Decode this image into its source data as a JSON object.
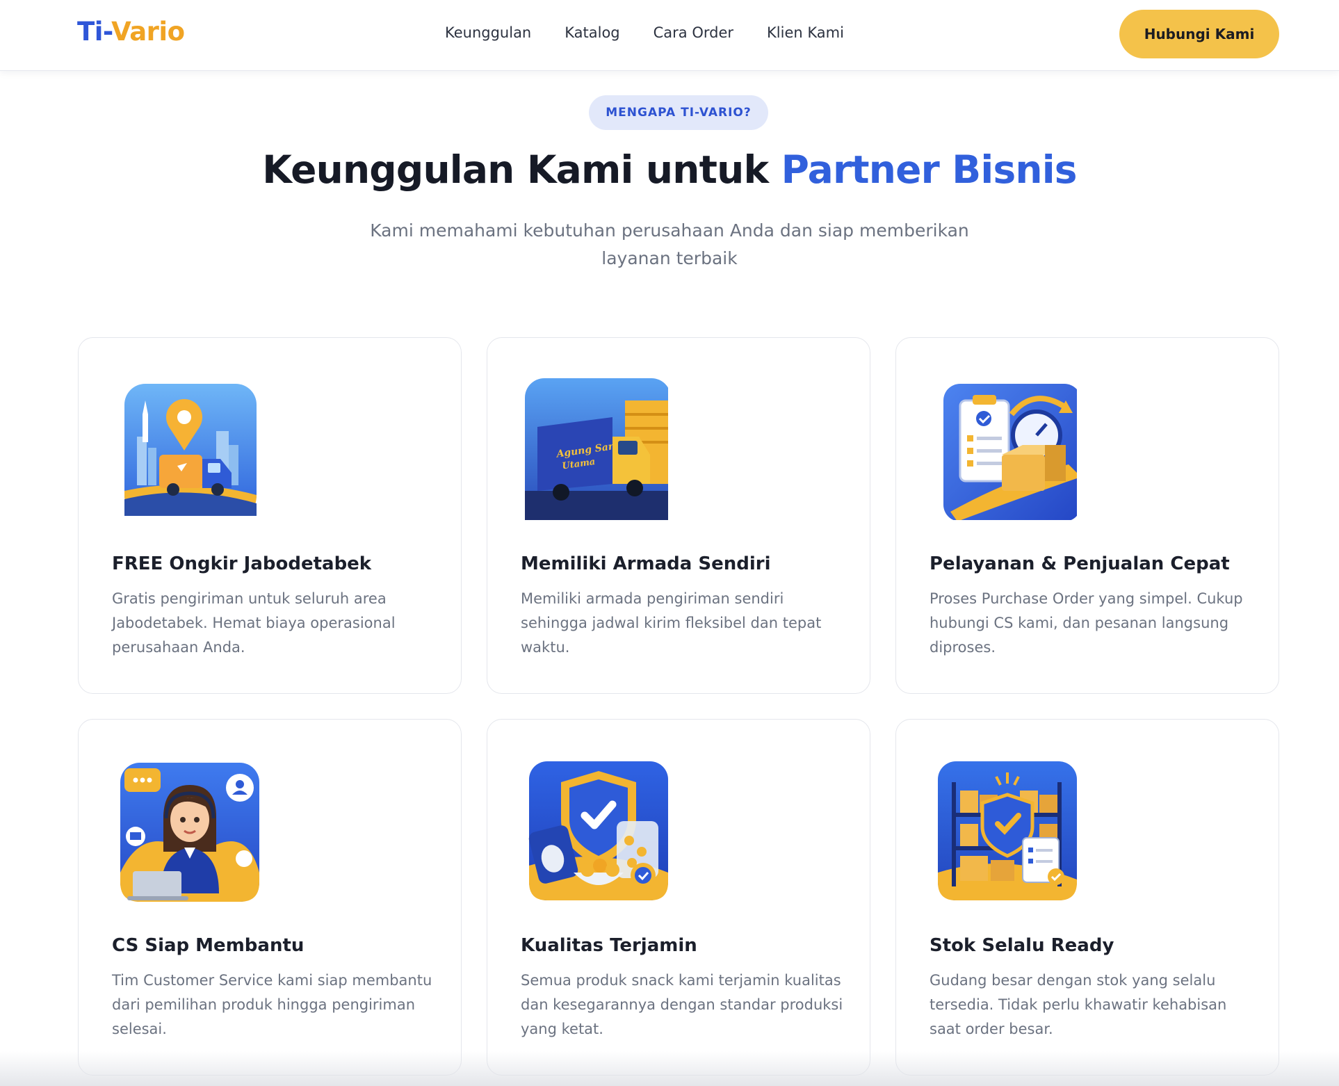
{
  "brand": {
    "name_part1": "Ti-",
    "name_part2": "Vario"
  },
  "nav": {
    "links": [
      {
        "label": "Keunggulan"
      },
      {
        "label": "Katalog"
      },
      {
        "label": "Cara Order"
      },
      {
        "label": "Klien Kami"
      }
    ],
    "cta_label": "Hubungi Kami"
  },
  "hero": {
    "badge": "MENGAPA TI-VARIO?",
    "title_main": "Keunggulan Kami untuk ",
    "title_accent": "Partner Bisnis",
    "subtitle": "Kami memahami kebutuhan perusahaan Anda dan siap memberikan layanan terbaik"
  },
  "features": [
    {
      "icon": "delivery-truck-icon",
      "title": "FREE Ongkir Jabodetabek",
      "description": "Gratis pengiriman untuk seluruh area Jabodetabek. Hemat biaya operasional perusahaan Anda."
    },
    {
      "icon": "fleet-truck-icon",
      "title": "Memiliki Armada Sendiri",
      "description": "Memiliki armada pengiriman sendiri sehingga jadwal kirim fleksibel dan tepat waktu."
    },
    {
      "icon": "fast-order-icon",
      "title": "Pelayanan & Penjualan Cepat",
      "description": "Proses Purchase Order yang simpel. Cukup hubungi CS kami, dan pesanan langsung diproses."
    },
    {
      "icon": "customer-service-icon",
      "title": "CS Siap Membantu",
      "description": "Tim Customer Service kami siap membantu dari pemilihan produk hingga pengiriman selesai."
    },
    {
      "icon": "quality-shield-icon",
      "title": "Kualitas Terjamin",
      "description": "Semua produk snack kami terjamin kualitas dan kesegarannya dengan standar produksi yang ketat."
    },
    {
      "icon": "warehouse-stock-icon",
      "title": "Stok Selalu Ready",
      "description": "Gudang besar dengan stok yang selalu tersedia. Tidak perlu khawatir kehabisan saat order besar."
    }
  ],
  "truck_lettering": "Agung Sari Utama",
  "colors": {
    "primary_blue": "#3160dc",
    "accent_yellow": "#f4c24a",
    "badge_bg": "#e2e8fa"
  }
}
